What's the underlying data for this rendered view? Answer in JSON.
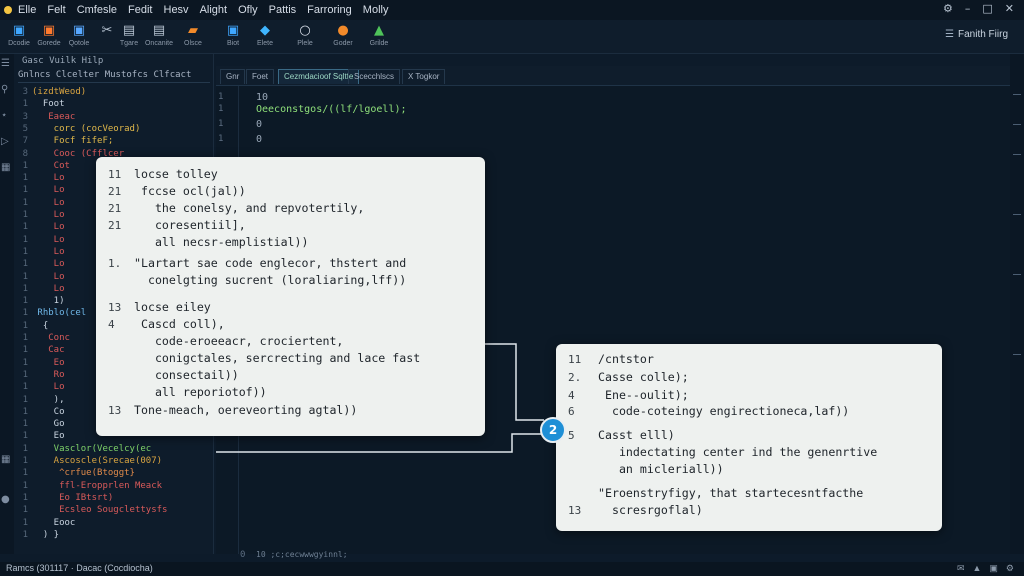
{
  "menu": {
    "items": [
      "Elle",
      "Felt",
      "Cmfesle",
      "Fedit",
      "Hesv",
      "Alight",
      "Ofly",
      "Pattis",
      "Farroring",
      "Molly"
    ]
  },
  "window_controls": {
    "settings": "⚙",
    "minimize": "–",
    "maximize": "□",
    "close": "✕"
  },
  "toolbar": {
    "tools": [
      {
        "icon": "▣",
        "label": "Dcodie",
        "color": "#3fa7ff"
      },
      {
        "icon": "▣",
        "label": "Gorede",
        "color": "#ff7a2e"
      },
      {
        "icon": "▣",
        "label": "Qotole",
        "color": "#58a8ff"
      },
      {
        "icon": "✂",
        "label": "",
        "color": "#b7c4d2"
      },
      {
        "icon": "▤",
        "label": "Tgare",
        "color": "#b7c4d2"
      },
      {
        "icon": "▤",
        "label": "Oncanite",
        "color": "#b7c4d2"
      },
      {
        "icon": "▰",
        "label": "Olsce",
        "color": "#f28a2a"
      },
      {
        "icon": "▣",
        "label": "Biot",
        "color": "#3fa7ff"
      },
      {
        "icon": "◆",
        "label": "Elete",
        "color": "#3fb5ff"
      },
      {
        "icon": "○",
        "label": "Plele",
        "color": "#d7dee8"
      },
      {
        "icon": "●",
        "label": "Goder",
        "color": "#f28a2a"
      },
      {
        "icon": "▲",
        "label": "Grilde",
        "color": "#4fc35a"
      }
    ],
    "right_label": "Fanith Fiirg"
  },
  "sidebar": {
    "title": "Gasc Vuilk Hilp",
    "tab_label": "Gnlncs Clcelter Mustofcs Clfcact",
    "lines": [
      {
        "n": "3",
        "t": "(izdtWeod)",
        "c": "#d9a441"
      },
      {
        "n": "1",
        "t": "  Foot",
        "c": "#c9d4e0"
      },
      {
        "n": "3",
        "t": "   Eaeac",
        "c": "#d95a5a"
      },
      {
        "n": "5",
        "t": "    corc (cocVeorad)",
        "c": "#e0b84a"
      },
      {
        "n": "7",
        "t": "    Focf fifeF;",
        "c": "#e0b84a"
      },
      {
        "n": "8",
        "t": "    Cooc (Cfflcer",
        "c": "#d95a5a"
      },
      {
        "n": "1",
        "t": "    Cot",
        "c": "#d95a5a"
      },
      {
        "n": "1",
        "t": "    Lo",
        "c": "#d95a5a"
      },
      {
        "n": "1",
        "t": "    Lo",
        "c": "#d95a5a"
      },
      {
        "n": "1",
        "t": "    Lo",
        "c": "#d95a5a"
      },
      {
        "n": "1",
        "t": "    Lo",
        "c": "#d95a5a"
      },
      {
        "n": "1",
        "t": "    Lo",
        "c": "#d95a5a"
      },
      {
        "n": "1",
        "t": "    Lo",
        "c": "#d95a5a"
      },
      {
        "n": "1",
        "t": "    Lo",
        "c": "#d95a5a"
      },
      {
        "n": "1",
        "t": "    Lo",
        "c": "#d95a5a"
      },
      {
        "n": "1",
        "t": "    Lo",
        "c": "#d95a5a"
      },
      {
        "n": "1",
        "t": "    Lo",
        "c": "#d95a5a"
      },
      {
        "n": "1",
        "t": "    1)",
        "c": "#c9d4e0"
      },
      {
        "n": "1",
        "t": " Rhblo(cel",
        "c": "#6fb7e8"
      },
      {
        "n": "1",
        "t": "  {",
        "c": "#c9d4e0"
      },
      {
        "n": "1",
        "t": "   Conc",
        "c": "#d95a5a"
      },
      {
        "n": "1",
        "t": "   Cac",
        "c": "#d95a5a"
      },
      {
        "n": "1",
        "t": "    Eo",
        "c": "#d95a5a"
      },
      {
        "n": "1",
        "t": "    Ro",
        "c": "#d95a5a"
      },
      {
        "n": "1",
        "t": "    Lo",
        "c": "#d95a5a"
      },
      {
        "n": "1",
        "t": "    ),",
        "c": "#c9d4e0"
      },
      {
        "n": "1",
        "t": "    Co",
        "c": "#c9d4e0"
      },
      {
        "n": "1",
        "t": "    Go",
        "c": "#c9d4e0"
      },
      {
        "n": "1",
        "t": "    Eo",
        "c": "#c9d4e0"
      },
      {
        "n": "1",
        "t": "    Vasclor(Vecelcy(ec",
        "c": "#7fd36a"
      },
      {
        "n": "1",
        "t": "    Ascoscle(Srecae(007)",
        "c": "#d9a441"
      },
      {
        "n": "1",
        "t": "     ^crfue(Btoggt}",
        "c": "#e08a4a"
      },
      {
        "n": "1",
        "t": "     ffl-Eropprlen Meack",
        "c": "#d95a5a"
      },
      {
        "n": "1",
        "t": "     Eo IBtsrt)",
        "c": "#d95a5a"
      },
      {
        "n": "1",
        "t": "     Ecsleo Sougclettysfs",
        "c": "#d95a5a"
      },
      {
        "n": "1",
        "t": "    Eooc",
        "c": "#c9d4e0"
      },
      {
        "n": "1",
        "t": "  ) }",
        "c": "#c9d4e0"
      }
    ]
  },
  "editor": {
    "tabs": [
      "Gnr",
      "Foet",
      "Cezmdacioof Sqltfe",
      "Scecchlscs",
      "X Togkor"
    ],
    "active_tab": 2,
    "lines": [
      {
        "n": "1",
        "t": "10"
      },
      {
        "n": "1",
        "t": "Oeeconstgos/((lf/lgoell);"
      },
      {
        "n": "1",
        "t": "0"
      },
      {
        "n": "1",
        "t": "0"
      }
    ],
    "bottom_line": {
      "n": "0",
      "t": "10 ;c;cecwwwgyinnl;"
    }
  },
  "status_bar": {
    "left": "Ramcs (301117 · Dacac (Cocdiocha)",
    "icons": [
      "✉",
      "▲",
      "▣",
      "⚙"
    ]
  },
  "panel_left": {
    "rows": [
      {
        "n": "11",
        "t": "locse tolley"
      },
      {
        "n": "21",
        "t": " fccse ocl(jal))"
      },
      {
        "n": "21",
        "t": "   the conelsy, and repvotertily,"
      },
      {
        "n": "21",
        "t": "   coresentiil],"
      },
      {
        "n": "",
        "t": "   all necsr-emplistial))"
      },
      {
        "n": "1.",
        "t": "\"Lartart sae code englecor, thstert and"
      },
      {
        "n": "",
        "t": "  conelgting sucrent (loraliaring,lff))"
      },
      {
        "n": "13",
        "t": "locse eiley"
      },
      {
        "n": "4",
        "t": " Cascd coll),"
      },
      {
        "n": "",
        "t": "   code-eroeeacr, crociertent,"
      },
      {
        "n": "",
        "t": "   conigctales, sercrecting and lace fast"
      },
      {
        "n": "",
        "t": "   consectail))"
      },
      {
        "n": "",
        "t": "   all reporiotof))"
      },
      {
        "n": "13",
        "t": "Tone-meach, oereveorting agtal))"
      }
    ]
  },
  "panel_right": {
    "rows": [
      {
        "n": "11",
        "t": "/cntstor"
      },
      {
        "n": "2.",
        "t": "Casse colle);"
      },
      {
        "n": "4",
        "t": " Ene--oulit);"
      },
      {
        "n": "6",
        "t": "  code-coteingy engirectioneca,laf))"
      },
      {
        "n": "5",
        "t": "Casst elll)"
      },
      {
        "n": "",
        "t": "   indectating center ind the genenrtive"
      },
      {
        "n": "",
        "t": "   an micleriall))"
      },
      {
        "n": "",
        "t": "\"Eroenstryfigy, that startecesntfacthe"
      },
      {
        "n": "13",
        "t": "  scresrgoflal)"
      }
    ]
  },
  "badge_label": "2"
}
